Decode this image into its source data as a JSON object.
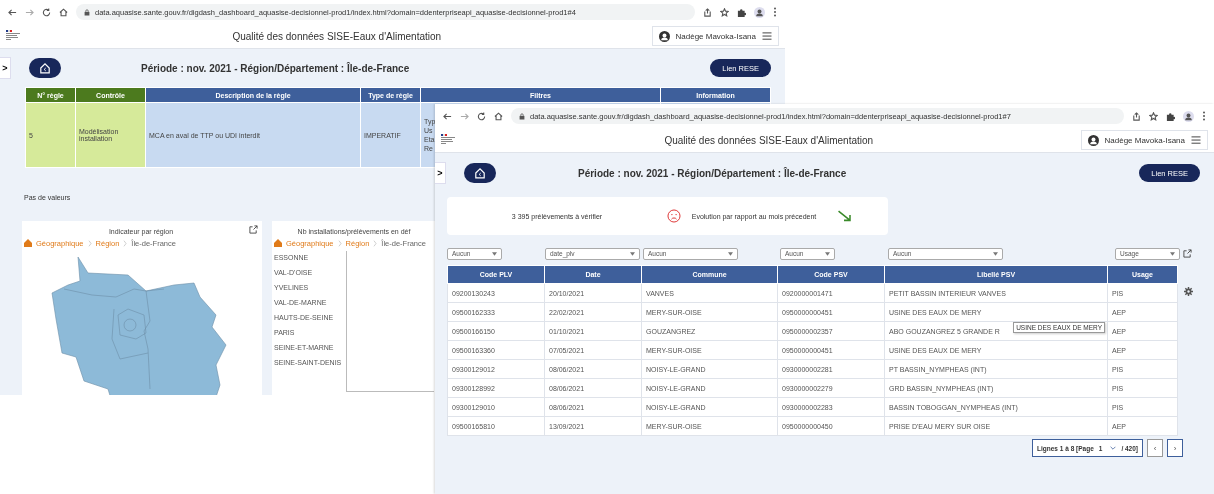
{
  "back_window": {
    "browser": {
      "url": "data.aquasise.sante.gouv.fr/digdash_dashboard_aquasise-decisionnel-prod1/index.html?domain=ddenterpriseapi_aquasise-decisionnel-prod1#4"
    },
    "app_title": "Qualité des données SISE-Eaux d'Alimentation",
    "user_name": "Nadège Mavoka-Isana",
    "sidebar_toggle": ">",
    "period": "Période : nov. 2021 - Région/Département : Île-de-France",
    "link_button": "Lien RESE",
    "rules_table": {
      "columns": [
        {
          "label": "N° règle",
          "kind": "control"
        },
        {
          "label": "Contrôle",
          "kind": "control"
        },
        {
          "label": "Description de la règle",
          "kind": "rule"
        },
        {
          "label": "Type de règle",
          "kind": "rule"
        },
        {
          "label": "Filtres",
          "kind": "rule"
        },
        {
          "label": "Information",
          "kind": "rule"
        }
      ],
      "rows": [
        {
          "cells": [
            "5",
            "Modélisation installation",
            "MCA en aval de TTP ou UDI interdit",
            "IMPERATIF"
          ],
          "filters": [
            "Typ",
            "Us",
            "Eta",
            "Re"
          ]
        }
      ]
    },
    "empty_message": "Pas de valeurs",
    "map_card": {
      "title": "Indicateur par région",
      "breadcrumb": [
        "Géographique",
        "Région",
        "Île-de-France"
      ]
    },
    "chart_card": {
      "title": "Nb installations/prélèvements en déf",
      "breadcrumb": [
        "Géographique",
        "Région",
        "Île-de-France"
      ],
      "departments": [
        "ESSONNE",
        "VAL-D'OISE",
        "YVELINES",
        "VAL-DE-MARNE",
        "HAUTS-DE-SEINE",
        "PARIS",
        "SEINE-ET-MARNE",
        "SEINE-SAINT-DENIS"
      ]
    }
  },
  "front_window": {
    "browser": {
      "url": "data.aquasise.sante.gouv.fr/digdash_dashboard_aquasise-decisionnel-prod1/index.html?domain=ddenterpriseapi_aquasise-decisionnel-prod1#7"
    },
    "app_title": "Qualité des données SISE-Eaux d'Alimentation",
    "user_name": "Nadège Mavoka-Isana",
    "sidebar_toggle": ">",
    "period": "Période : nov. 2021 - Région/Département : Île-de-France",
    "link_button": "Lien RESE",
    "kpi": {
      "count": "3 395 prélèvements à vérifier",
      "evolution": "Evolution par rapport au mois précedent"
    },
    "filters": [
      "Aucun",
      "date_plv",
      "Aucun",
      "Aucun",
      "Aucun",
      "Usage"
    ],
    "table": {
      "columns": [
        "Code PLV",
        "Date",
        "Commune",
        "Code PSV",
        "Libellé PSV",
        "Usage"
      ],
      "rows": [
        {
          "cells": [
            "09200130243",
            "20/10/2021",
            "VANVES",
            "0920000001471",
            "PETIT BASSIN INTERIEUR VANVES",
            "PIS"
          ]
        },
        {
          "cells": [
            "09500162333",
            "22/02/2021",
            "MERY-SUR-OISE",
            "0950000000451",
            "USINE DES EAUX DE MERY",
            "AEP"
          ]
        },
        {
          "cells": [
            "09500166150",
            "01/10/2021",
            "GOUZANGREZ",
            "0950000002357",
            "ABO GOUZANGREZ 5 GRANDE R",
            "AEP"
          ],
          "tooltip": "USINE DES EAUX DE MERY"
        },
        {
          "cells": [
            "09500163360",
            "07/05/2021",
            "MERY-SUR-OISE",
            "0950000000451",
            "USINE DES EAUX DE MERY",
            "AEP"
          ]
        },
        {
          "cells": [
            "09300129012",
            "08/06/2021",
            "NOISY-LE-GRAND",
            "0930000002281",
            "PT BASSIN_NYMPHEAS (INT)",
            "PIS"
          ]
        },
        {
          "cells": [
            "09300128992",
            "08/06/2021",
            "NOISY-LE-GRAND",
            "0930000002279",
            "GRD BASSIN_NYMPHEAS (INT)",
            "PIS"
          ]
        },
        {
          "cells": [
            "09300129010",
            "08/06/2021",
            "NOISY-LE-GRAND",
            "0930000002283",
            "BASSIN TOBOGGAN_NYMPHEAS (INT)",
            "PIS"
          ]
        },
        {
          "cells": [
            "09500165810",
            "13/09/2021",
            "MERY-SUR-OISE",
            "0950000000450",
            "PRISE D'EAU MERY SUR OISE",
            "AEP"
          ]
        }
      ]
    },
    "pagination": {
      "range": "Lignes 1 à 8 [Page",
      "page": "1",
      "total": "/ 420]",
      "prev": "‹",
      "next": "›"
    }
  }
}
